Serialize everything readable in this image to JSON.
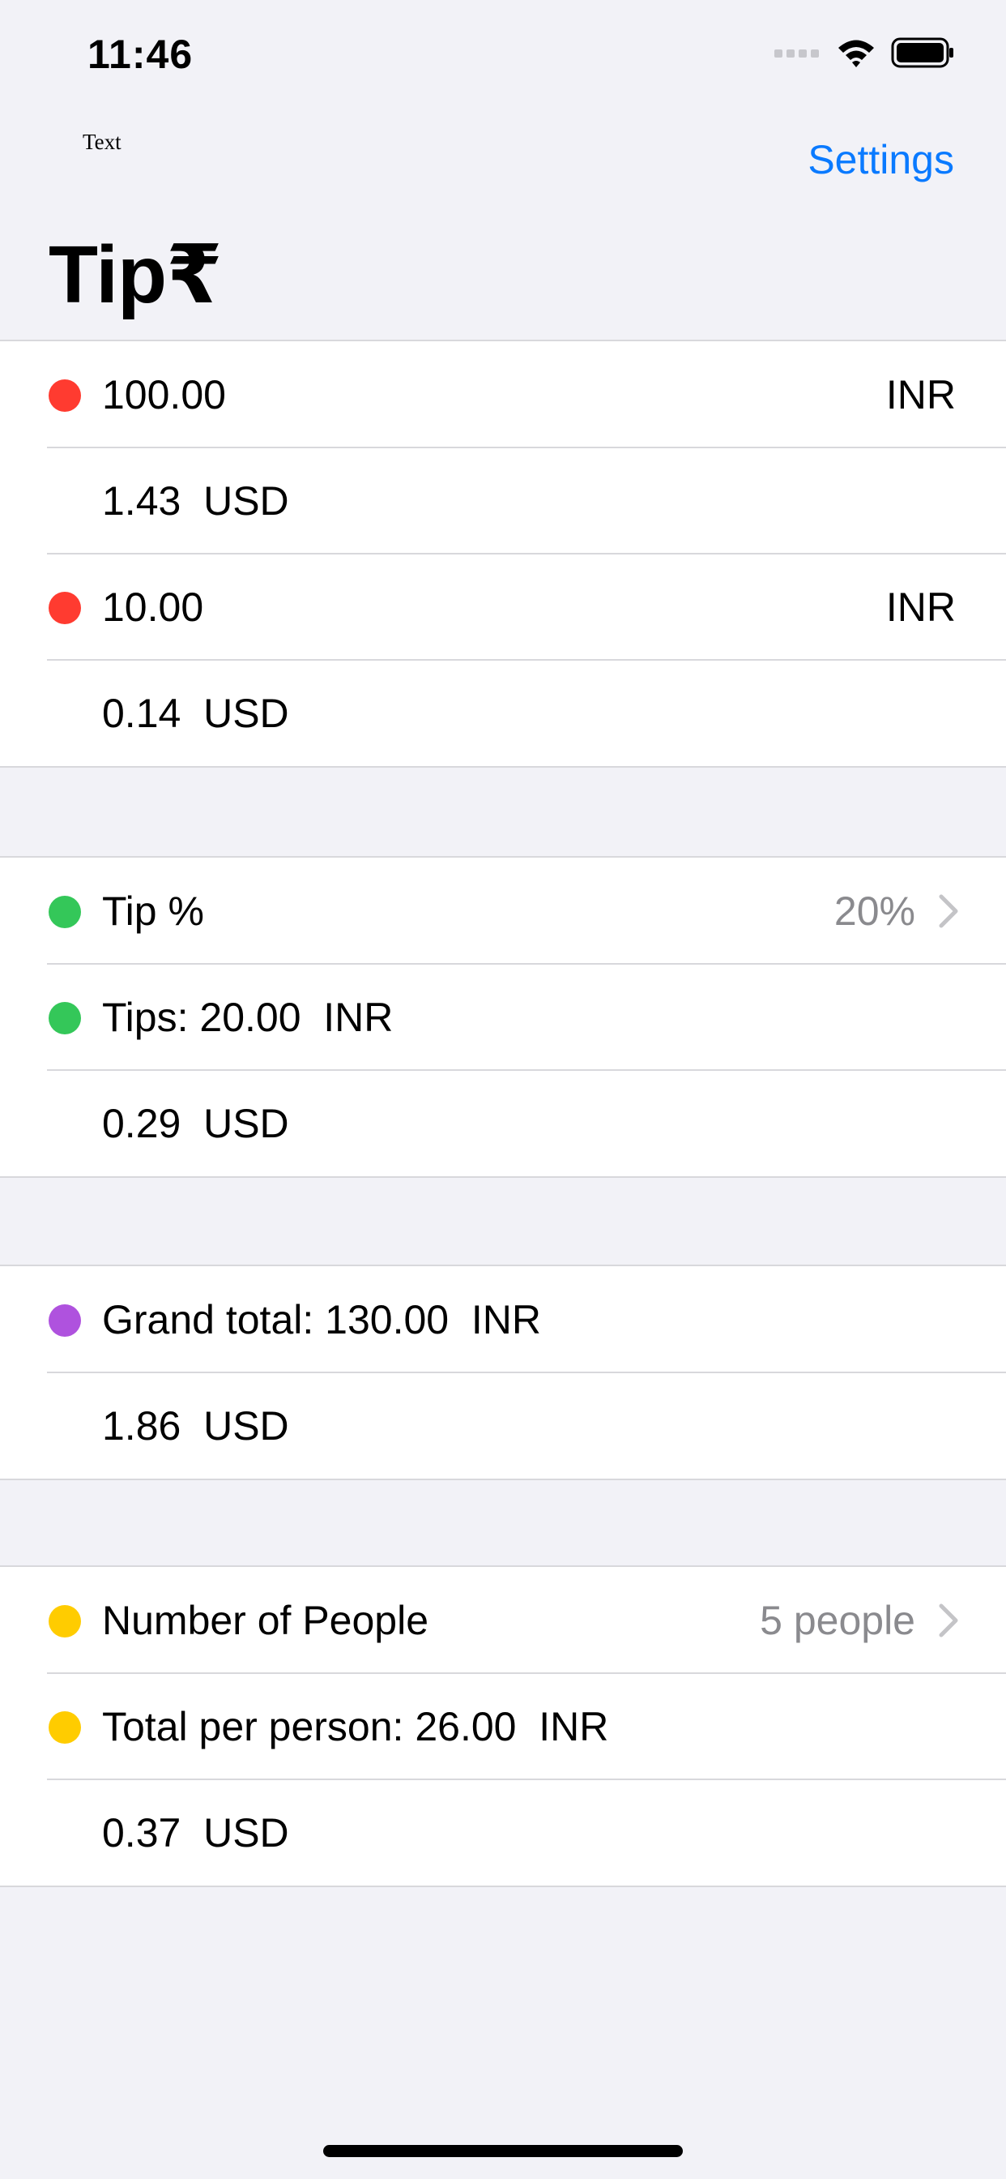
{
  "status_bar": {
    "time": "11:46"
  },
  "nav": {
    "small_text": "Text",
    "settings_label": "Settings",
    "title": "Tip₹"
  },
  "colors": {
    "red": "#FF3B30",
    "green": "#34C759",
    "purple": "#AF52DE",
    "yellow": "#FFCC00",
    "accent": "#0A7AFF"
  },
  "bill": {
    "amount": {
      "value": "100.00",
      "currency": "INR"
    },
    "amount_usd": "1.43  USD",
    "second_amount": {
      "value": "10.00",
      "currency": "INR"
    },
    "second_amount_usd": "0.14  USD"
  },
  "tip": {
    "percent_label": "Tip %",
    "percent_value": "20%",
    "tips_text": "Tips: 20.00  INR",
    "tips_usd": "0.29  USD"
  },
  "total": {
    "grand_total_text": "Grand total: 130.00  INR",
    "grand_total_usd": "1.86  USD"
  },
  "people": {
    "label": "Number of People",
    "value": "5 people",
    "per_person_text": "Total per person: 26.00  INR",
    "per_person_usd": "0.37  USD"
  }
}
